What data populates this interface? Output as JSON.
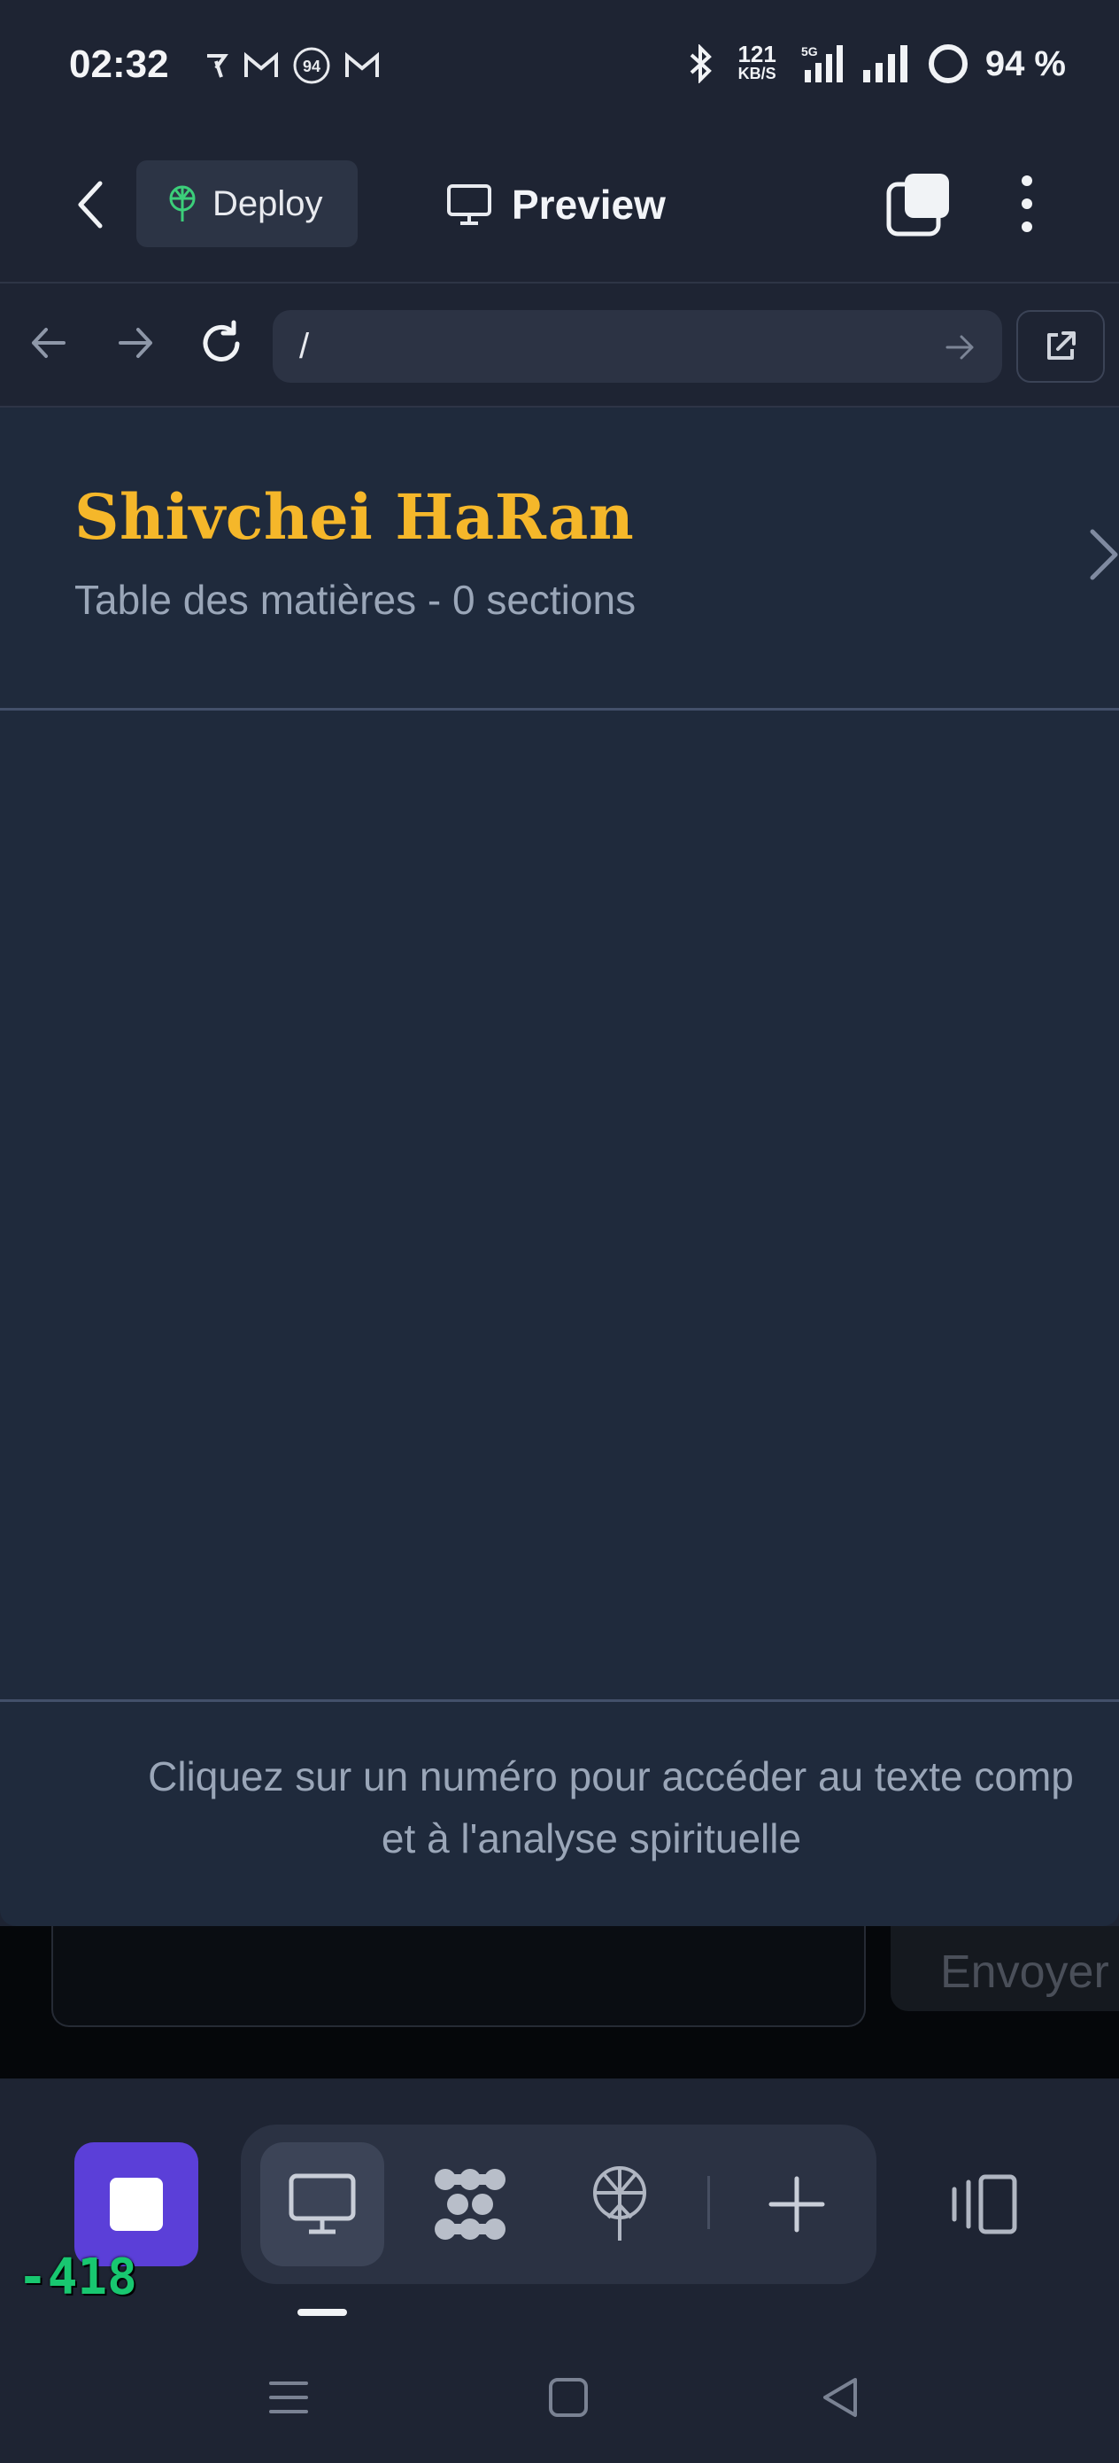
{
  "status_bar": {
    "time": "02:32",
    "speed_value": "121",
    "speed_unit": "KB/S",
    "network": "5G",
    "battery": "94 %"
  },
  "header": {
    "deploy_label": "Deploy",
    "preview_label": "Preview"
  },
  "browser": {
    "url": "/"
  },
  "document": {
    "title": "Shivchei HaRan",
    "subtitle": "Table des matières - 0 sections",
    "footer_line1": "Cliquez sur un numéro pour accéder au texte comp",
    "footer_line2": "et à l'analyse spirituelle"
  },
  "chat": {
    "send_label": "Envoyer"
  },
  "toolbar": {
    "counter": "-418"
  },
  "colors": {
    "background": "#1e2433",
    "surface": "#1f2a3c",
    "title_gold": "#f5b72a",
    "stop_purple": "#5b3fd8",
    "counter_green": "#18c770"
  }
}
